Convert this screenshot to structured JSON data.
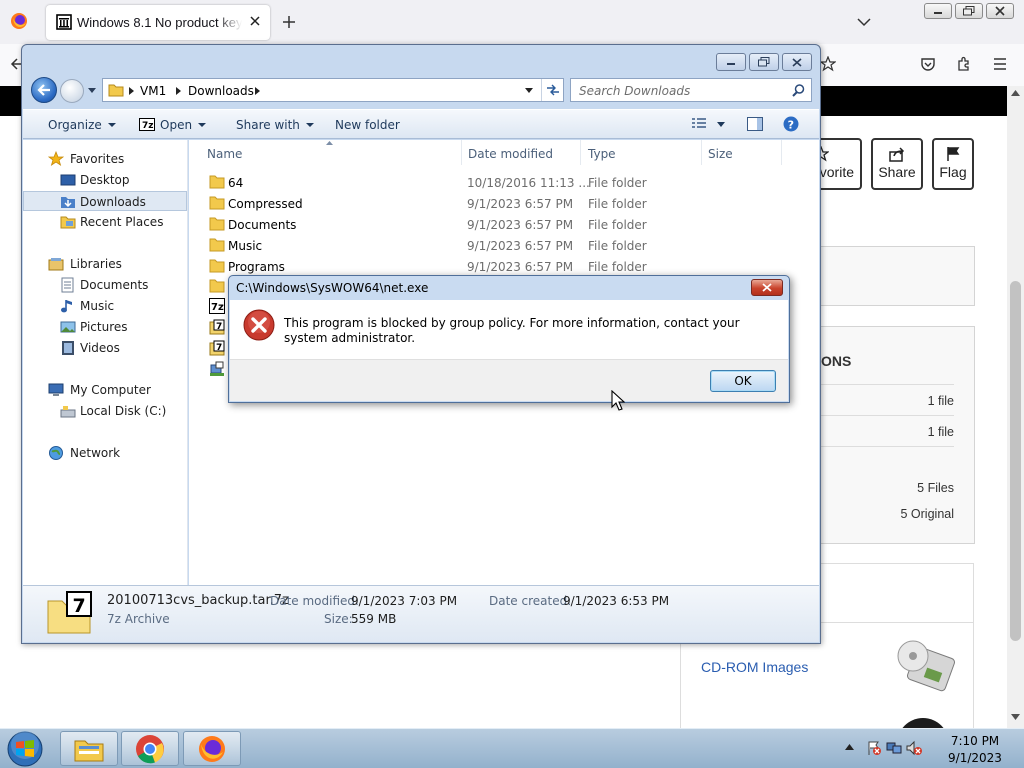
{
  "browser": {
    "tab_title": "Windows 8.1 No product key re",
    "colors": {
      "tabbar": "#f0f0f4",
      "accent": "#2a5db0"
    }
  },
  "site": {
    "favorite_label": "vorite",
    "share_label": "Share",
    "flag_label": "Flag",
    "panel_title": "ONS",
    "rows": [
      "1 file",
      "1 file",
      "5 Files",
      "5 Original"
    ],
    "cdrom_link": "CD-ROM Images"
  },
  "explorer": {
    "breadcrumb": [
      "VM1",
      "Downloads"
    ],
    "search_placeholder": "Search Downloads",
    "toolbar": {
      "organize": "Organize",
      "open": "Open",
      "share_with": "Share with",
      "new_folder": "New folder"
    },
    "nav": {
      "favorites": "Favorites",
      "desktop": "Desktop",
      "downloads": "Downloads",
      "recent_places": "Recent Places",
      "libraries": "Libraries",
      "documents": "Documents",
      "music": "Music",
      "pictures": "Pictures",
      "videos": "Videos",
      "my_computer": "My Computer",
      "local_disk": "Local Disk (C:)",
      "network": "Network"
    },
    "columns": {
      "name": "Name",
      "date_modified": "Date modified",
      "type": "Type",
      "size": "Size"
    },
    "files": [
      {
        "name": "64",
        "date": "10/18/2016 11:13 ...",
        "type": "File folder"
      },
      {
        "name": "Compressed",
        "date": "9/1/2023 6:57 PM",
        "type": "File folder"
      },
      {
        "name": "Documents",
        "date": "9/1/2023 6:57 PM",
        "type": "File folder"
      },
      {
        "name": "Music",
        "date": "9/1/2023 6:57 PM",
        "type": "File folder"
      },
      {
        "name": "Programs",
        "date": "9/1/2023 6:57 PM",
        "type": "File folder"
      }
    ],
    "details": {
      "filename": "20100713cvs_backup.tar.7z",
      "filetype": "7z Archive",
      "date_modified_label": "Date modified:",
      "date_modified": "9/1/2023 7:03 PM",
      "size_label": "Size:",
      "size": "559 MB",
      "date_created_label": "Date created:",
      "date_created": "9/1/2023 6:53 PM"
    }
  },
  "dialog": {
    "title": "C:\\Windows\\SysWOW64\\net.exe",
    "message": "This program is blocked by group policy. For more information, contact your system administrator.",
    "ok_label": "OK",
    "icon": "error-icon"
  },
  "taskbar": {
    "time": "7:10 PM",
    "date": "9/1/2023",
    "apps": [
      "windows-explorer",
      "google-chrome",
      "firefox"
    ]
  }
}
